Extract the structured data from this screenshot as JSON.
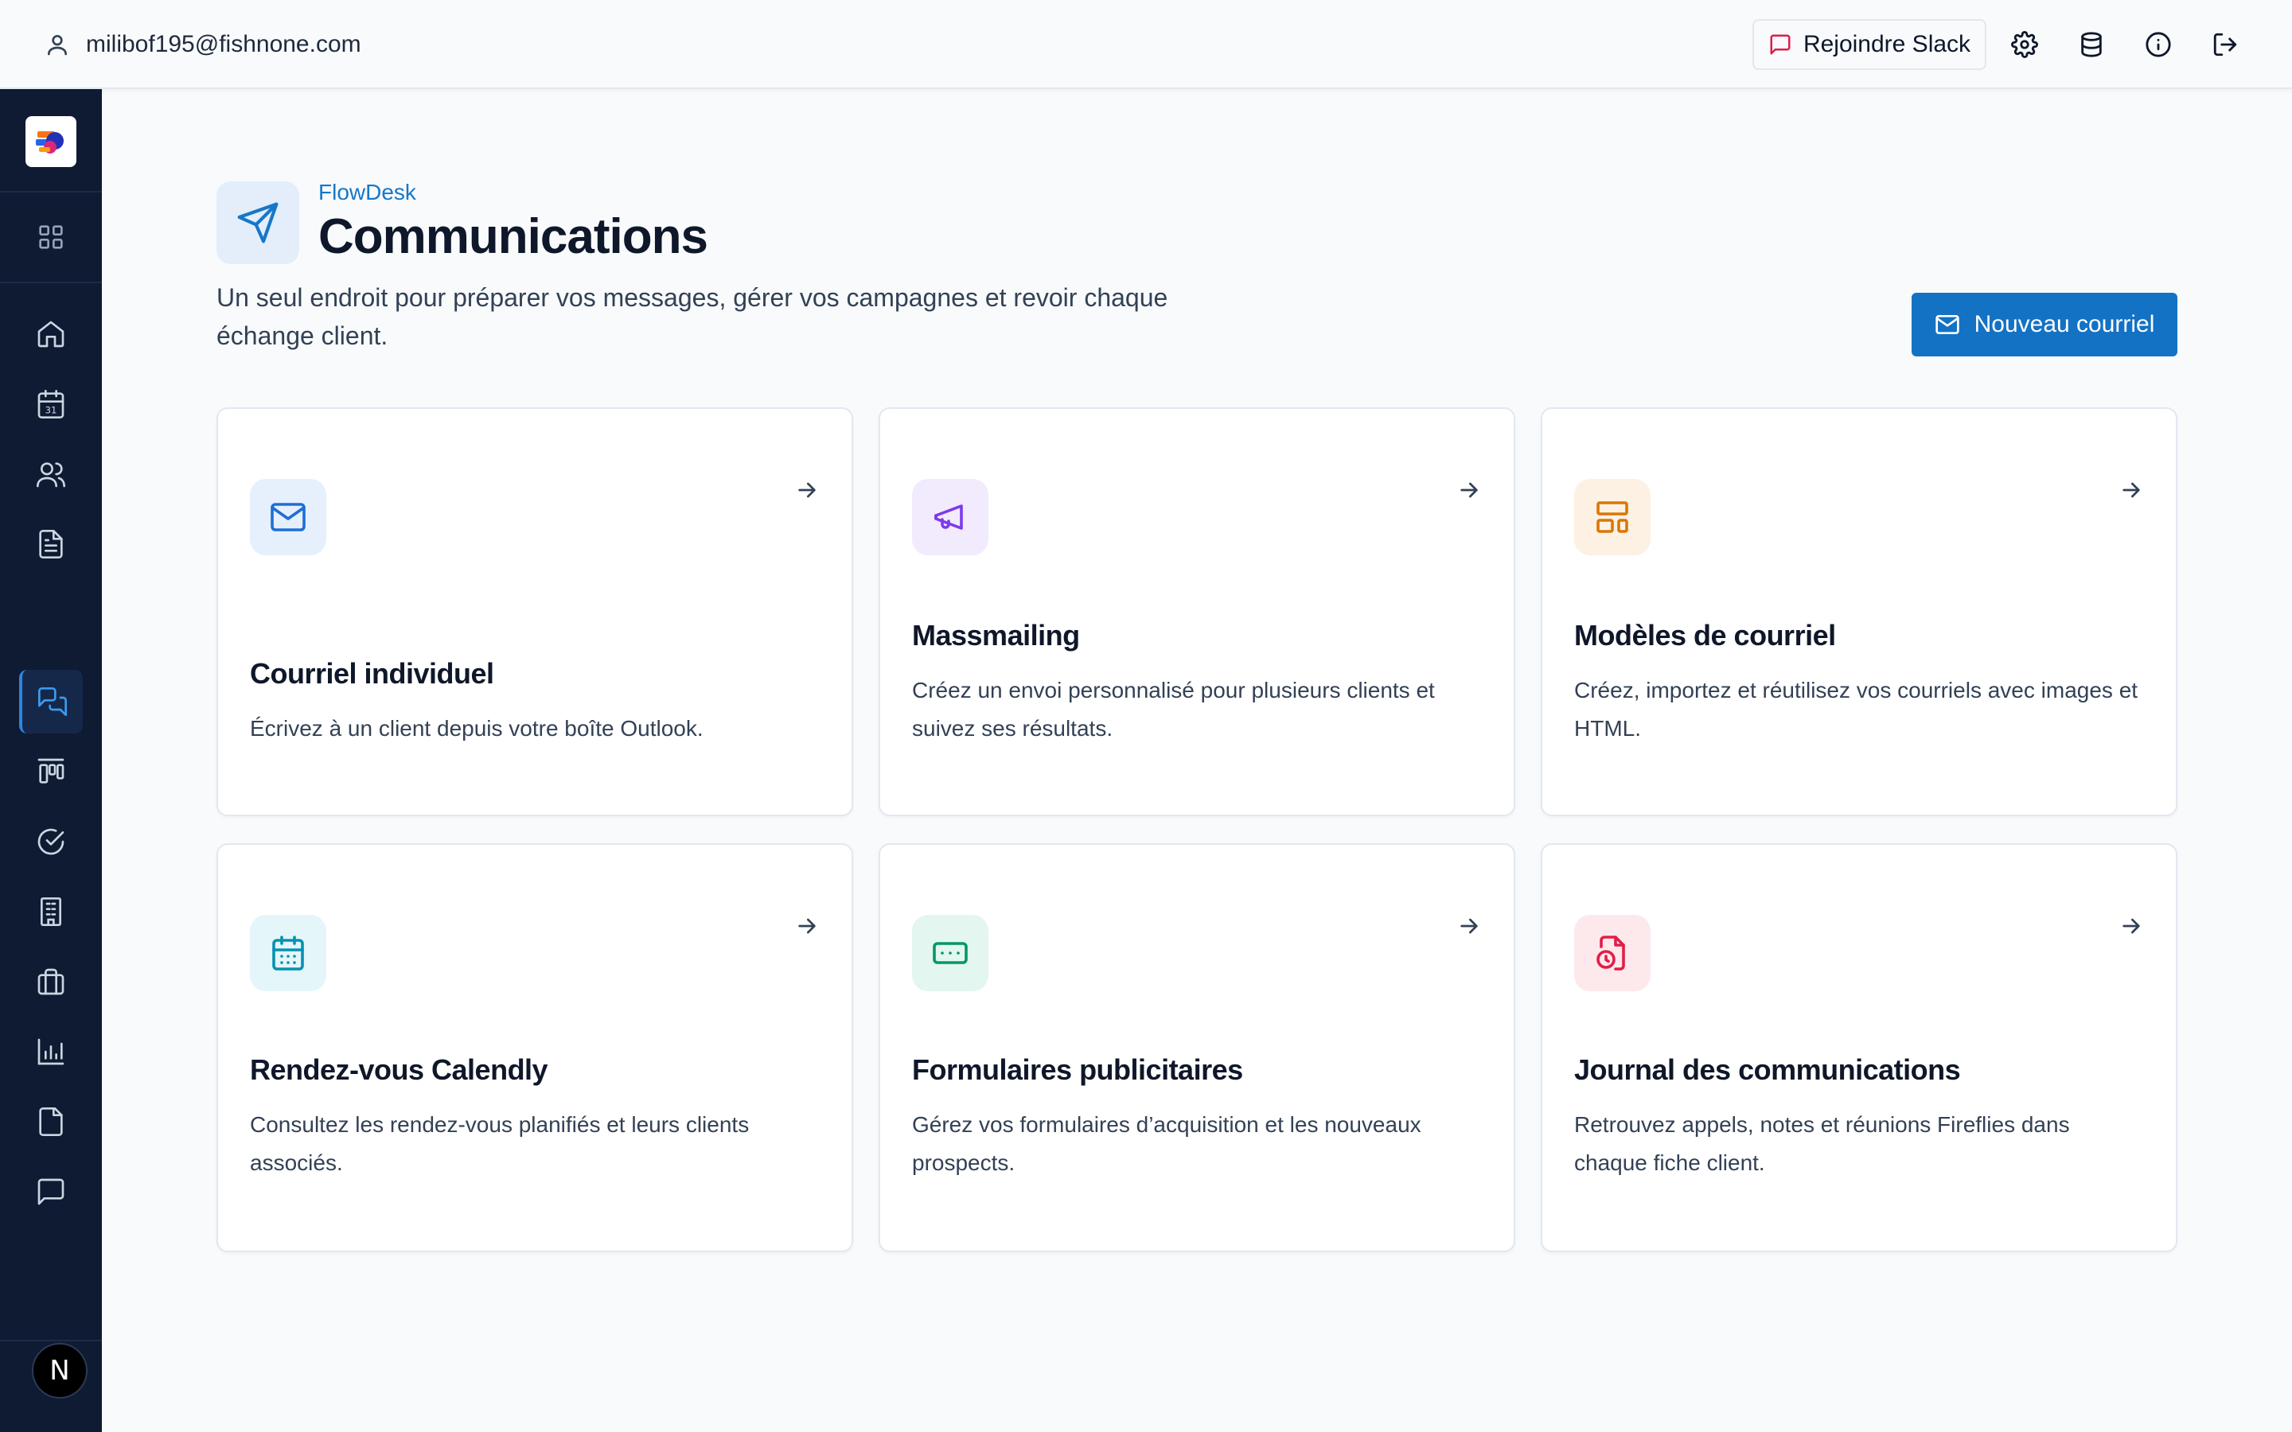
{
  "topbar": {
    "user_email": "milibof195@fishnone.com",
    "slack_label": "Rejoindre Slack",
    "icons": [
      "settings-icon",
      "database-icon",
      "info-icon",
      "logout-icon"
    ]
  },
  "sidebar": {
    "items": [
      "grid-icon",
      "home-icon",
      "calendar-icon",
      "users-icon",
      "document-icon",
      "messages-icon",
      "kanban-icon",
      "check-circle-icon",
      "building-icon",
      "briefcase-icon",
      "bar-chart-icon",
      "file-icon",
      "chat-icon"
    ],
    "active": "messages-icon",
    "avatar_letter": "N"
  },
  "header": {
    "brand": "FlowDesk",
    "title": "Communications",
    "description": "Un seul endroit pour préparer vos messages, gérer vos campagnes et revoir chaque échange client.",
    "primary_button": "Nouveau courriel"
  },
  "cards": [
    {
      "title": "Courriel individuel",
      "description": "Écrivez à un client depuis votre boîte Outlook.",
      "icon": "mail-icon",
      "color": "#1d6fd6",
      "bg": "#e6f0fc"
    },
    {
      "title": "Massmailing",
      "description": "Créez un envoi personnalisé pour plusieurs clients et suivez ses résultats.",
      "icon": "megaphone-icon",
      "color": "#7c3aed",
      "bg": "#f1ebfd"
    },
    {
      "title": "Modèles de courriel",
      "description": "Créez, importez et réutilisez vos courriels avec images et HTML.",
      "icon": "layout-template-icon",
      "color": "#d97706",
      "bg": "#fdf1e3"
    },
    {
      "title": "Rendez-vous Calendly",
      "description": "Consultez les rendez-vous planifiés et leurs clients associés.",
      "icon": "calendar-days-icon",
      "color": "#0891b2",
      "bg": "#e4f6f9"
    },
    {
      "title": "Formulaires publicitaires",
      "description": "Gérez vos formulaires d’acquisition et les nouveaux prospects.",
      "icon": "form-icon",
      "color": "#059669",
      "bg": "#e3f6ef"
    },
    {
      "title": "Journal des communications",
      "description": "Retrouvez appels, notes et réunions Fireflies dans chaque fiche client.",
      "icon": "file-clock-icon",
      "color": "#e11d48",
      "bg": "#fde8ec"
    }
  ]
}
